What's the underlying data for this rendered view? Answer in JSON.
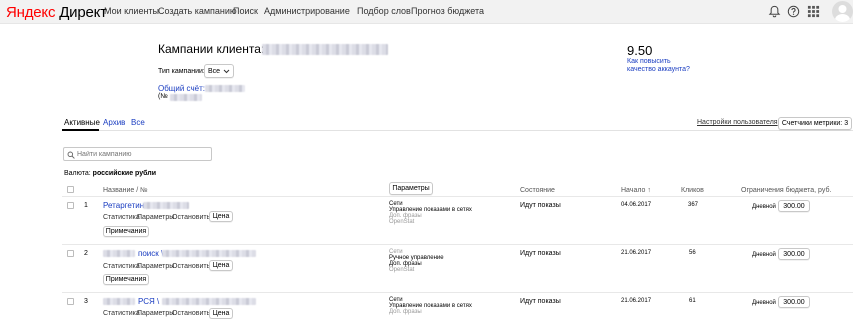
{
  "header": {
    "logo_brand": "Яндекс",
    "logo_product": "Директ",
    "nav": [
      "Мои клиенты",
      "Создать кампанию",
      "Поиск",
      "Администрирование"
    ],
    "nav2": [
      "Подбор слов",
      "Прогноз бюджета"
    ]
  },
  "client": {
    "title": "Кампании клиента:",
    "campaign_type_label": "Тип кампании:",
    "campaign_type_value": "Все",
    "account_label": "Общий счёт:",
    "account_no_prefix": "(№",
    "score": "9.50",
    "score_link_line1": "Как повысить",
    "score_link_line2": "качество аккаунта?"
  },
  "tabs": {
    "active": "Активные",
    "archive": "Архив",
    "all": "Все",
    "user_settings": "Настройки пользователя",
    "metrics_counters": "Счетчики метрики: 3"
  },
  "search": {
    "placeholder": "Найти кампанию"
  },
  "currency": {
    "label": "Валюта:",
    "value": "российские рубли"
  },
  "table": {
    "col_name": "Название / №",
    "params_button": "Параметры",
    "col_state": "Состояние",
    "col_start": "Начало ↑",
    "col_clicks": "Кликов",
    "col_budget": "Ограничения бюджета, руб.",
    "rows": [
      {
        "num": "1",
        "name": "Ретаргетинг",
        "actions": [
          "Статистика",
          "Параметры",
          "Остановить"
        ],
        "price_btn": "Цена",
        "notes_btn": "Примечания",
        "settings": [
          "Сети",
          "Управление показами в сетях",
          "Доп. фразы",
          "OpenStat"
        ],
        "state": "Идут показы",
        "start": "04.06.2017",
        "clicks": "367",
        "budget_type": "Дневной",
        "budget": "300.00"
      },
      {
        "num": "2",
        "name": "поиск \\",
        "actions": [
          "Статистика",
          "Параметры",
          "Остановить"
        ],
        "price_btn": "Цена",
        "notes_btn": "Примечания",
        "settings": [
          "Сети",
          "Ручное управление",
          "Доп. фразы",
          "OpenStat"
        ],
        "state": "Идут показы",
        "start": "21.06.2017",
        "clicks": "56",
        "budget_type": "Дневной",
        "budget": "300.00"
      },
      {
        "num": "3",
        "name": "РСЯ \\",
        "actions": [
          "Статистика",
          "Параметры",
          "Остановить"
        ],
        "price_btn": "Цена",
        "settings": [
          "Сети",
          "Управление показами в сетях",
          "Доп. фразы"
        ],
        "state": "Идут показы",
        "start": "21.06.2017",
        "clicks": "61",
        "budget_type": "Дневной",
        "budget": "300.00"
      }
    ]
  }
}
